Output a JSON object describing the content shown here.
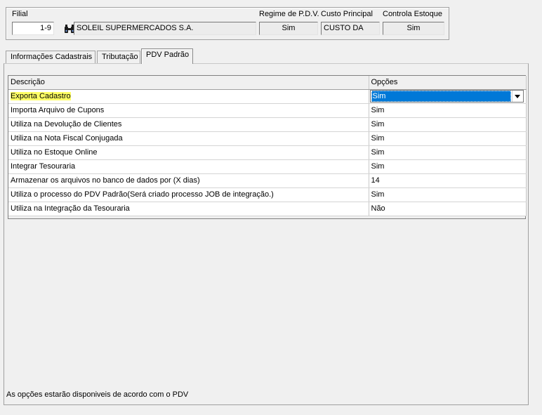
{
  "header": {
    "filial_label": "Filial",
    "filial_code": "1-9",
    "filial_name": "SOLEIL SUPERMERCADOS S.A.",
    "search_icon": "binoculars-icon",
    "regime_label": "Regime de P.D.V.",
    "regime_value": "Sim",
    "custo_label": "Custo Principal",
    "custo_value": "CUSTO DA",
    "estoque_label": "Controla Estoque",
    "estoque_value": "Sim"
  },
  "tabs": [
    {
      "label": "Informações Cadastrais",
      "active": false
    },
    {
      "label": "Tributação",
      "active": false
    },
    {
      "label": "PDV Padrão",
      "active": true
    }
  ],
  "grid": {
    "columns": [
      "Descrição",
      "Opções"
    ],
    "rows": [
      {
        "descricao": "Exporta Cadastro",
        "opcao": "Sim"
      },
      {
        "descricao": "Importa Arquivo de Cupons",
        "opcao": "Sim"
      },
      {
        "descricao": "Utiliza na Devolução de Clientes",
        "opcao": "Sim"
      },
      {
        "descricao": "Utiliza na Nota Fiscal Conjugada",
        "opcao": "Sim"
      },
      {
        "descricao": "Utiliza no Estoque Online",
        "opcao": "Sim"
      },
      {
        "descricao": "Integrar Tesouraria",
        "opcao": "Sim"
      },
      {
        "descricao": "Armazenar os arquivos no banco de dados por (X dias)",
        "opcao": "14"
      },
      {
        "descricao": "Utiliza o processo do PDV Padrão(Será criado processo JOB de integração.)",
        "opcao": "Sim"
      },
      {
        "descricao": "Utiliza na Integração da Tesouraria",
        "opcao": "Não"
      }
    ],
    "highlight_color": "#ffff66",
    "selection_color": "#0078d7"
  },
  "footer": {
    "note": "As opções estarão disponiveis de acordo com o PDV"
  }
}
